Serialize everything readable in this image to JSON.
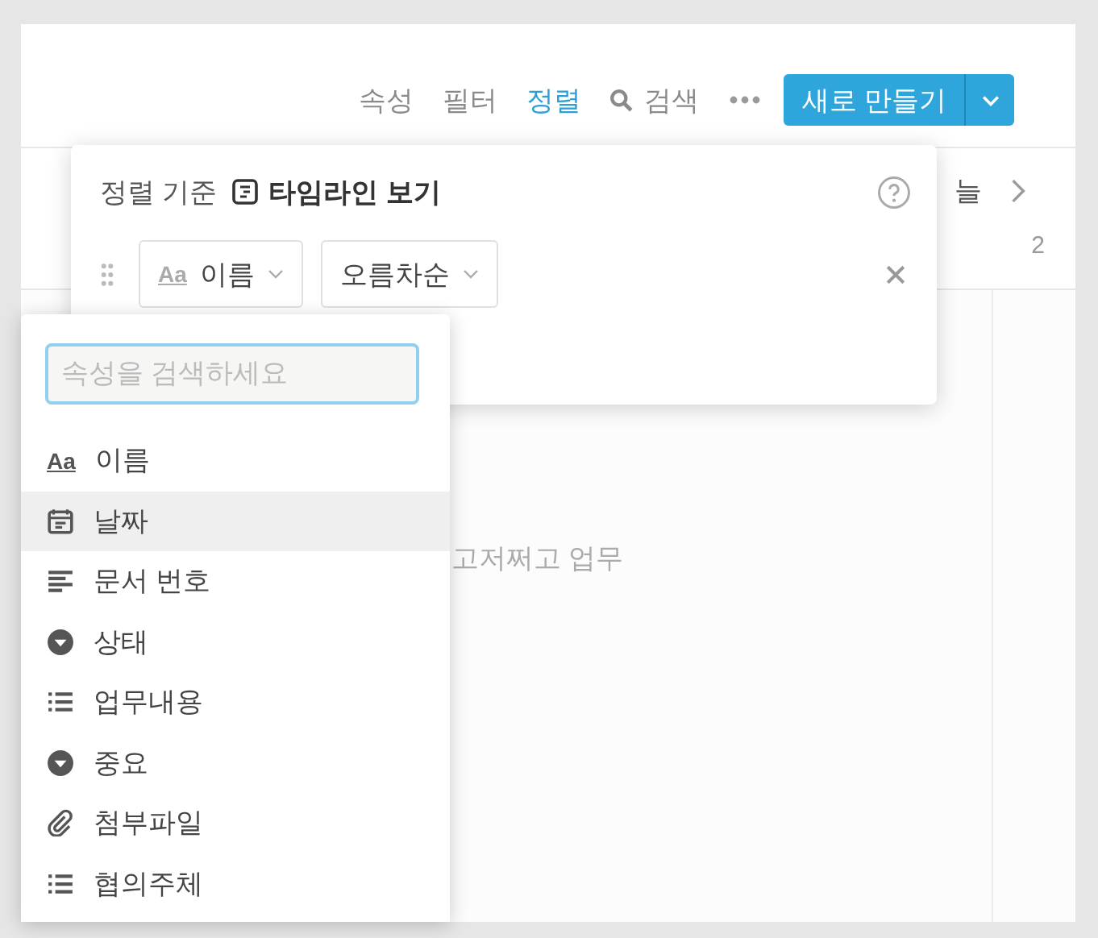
{
  "toolbar": {
    "items": [
      {
        "label": "속성",
        "kind": "text",
        "selected": false
      },
      {
        "label": "필터",
        "kind": "text",
        "selected": false
      },
      {
        "label": "정렬",
        "kind": "text",
        "selected": true
      },
      {
        "label": "검색",
        "kind": "search",
        "selected": false
      }
    ],
    "new_button": "새로 만들기"
  },
  "background": {
    "header_text": "늘",
    "column_number": "2",
    "body_text": "고저쩌고 업무"
  },
  "sort_popover": {
    "title": "정렬 기준",
    "view_name": "타임라인 보기",
    "rules": [
      {
        "glyph": "Aa",
        "property": "이름",
        "direction": "오름차순"
      }
    ]
  },
  "property_menu": {
    "placeholder": "속성을 검색하세요",
    "items": [
      {
        "kind": "text",
        "glyph": "Aa",
        "label": "이름",
        "selected": false
      },
      {
        "kind": "date",
        "label": "날짜",
        "selected": true
      },
      {
        "kind": "number",
        "label": "문서 번호",
        "selected": false
      },
      {
        "kind": "select",
        "label": "상태",
        "selected": false
      },
      {
        "kind": "list",
        "label": "업무내용",
        "selected": false
      },
      {
        "kind": "select",
        "label": "중요",
        "selected": false
      },
      {
        "kind": "file",
        "label": "첨부파일",
        "selected": false
      },
      {
        "kind": "list",
        "label": "협의주체",
        "selected": false
      }
    ]
  }
}
